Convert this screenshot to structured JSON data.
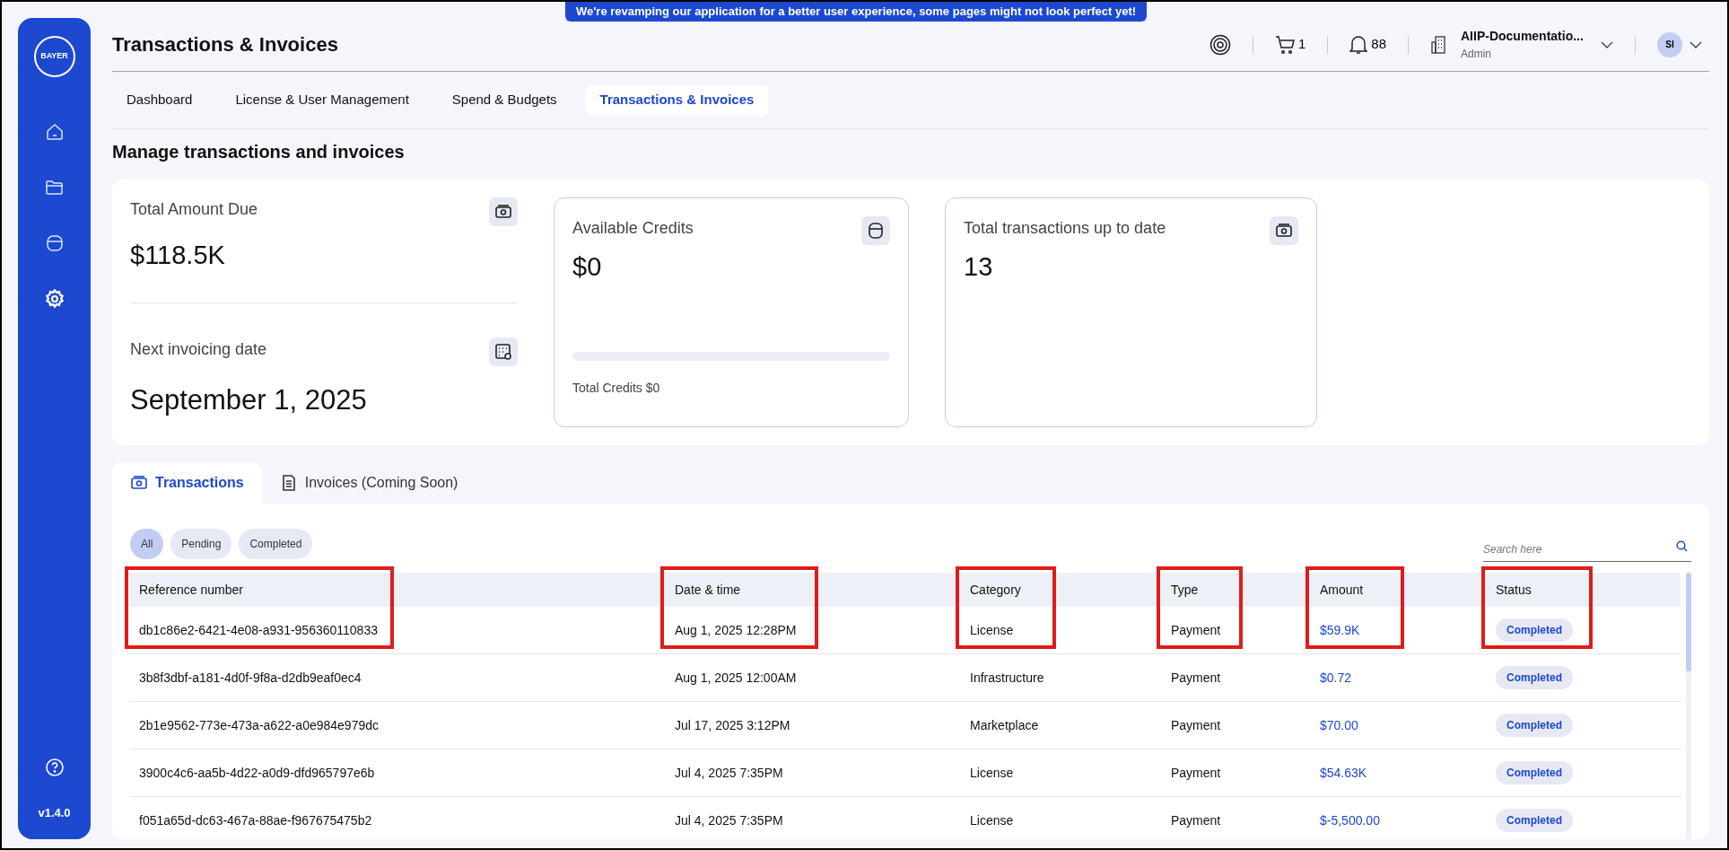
{
  "banner": "We're revamping our application for a better user experience, some pages might not look perfect yet!",
  "sidebar": {
    "logo": "BAYER",
    "items": [
      {
        "selected": false
      },
      {
        "selected": false
      },
      {
        "selected": false
      },
      {
        "selected": true
      }
    ],
    "version": "v1.4.0"
  },
  "header": {
    "title": "Transactions & Invoices",
    "cart_count": "1",
    "notification_count": "88",
    "org_name": "AIIP-Documentatio...",
    "org_role": "Admin",
    "avatar_initials": "SI"
  },
  "nav_tabs": [
    {
      "label": "Dashboard",
      "selected": false
    },
    {
      "label": "License & User Management",
      "selected": false
    },
    {
      "label": "Spend & Budgets",
      "selected": false
    },
    {
      "label": "Transactions & Invoices",
      "selected": true
    }
  ],
  "section_title": "Manage transactions and invoices",
  "summary": {
    "total_amount_due": {
      "label": "Total Amount Due",
      "value": "$118.5K"
    },
    "next_invoicing_date": {
      "label": "Next invoicing date",
      "value": "September 1, 2025"
    }
  },
  "credits": {
    "label": "Available Credits",
    "value": "$0",
    "level": 0,
    "footer": "Total Credits $0"
  },
  "total_transactions": {
    "label": "Total transactions up to date",
    "value": "13"
  },
  "content_tabs": [
    {
      "label": "Transactions",
      "selected": true
    },
    {
      "label": "Invoices (Coming Soon)",
      "selected": false
    }
  ],
  "filters": [
    {
      "label": "All",
      "selected": true
    },
    {
      "label": "Pending",
      "selected": false
    },
    {
      "label": "Completed",
      "selected": false
    }
  ],
  "search": {
    "placeholder": "Search here"
  },
  "table": {
    "columns": [
      {
        "label": "Reference number",
        "highlighted": true
      },
      {
        "label": "Date & time",
        "highlighted": true
      },
      {
        "label": "Category",
        "highlighted": true
      },
      {
        "label": "Type",
        "highlighted": true
      },
      {
        "label": "Amount",
        "highlighted": true
      },
      {
        "label": "Status",
        "highlighted": true
      }
    ],
    "rows": [
      [
        "db1c86e2-6421-4e08-a931-956360110833",
        "Aug 1, 2025 12:28PM",
        "License",
        "Payment",
        "$59.9K",
        "Completed"
      ],
      [
        "3b8f3dbf-a181-4d0f-9f8a-d2db9eaf0ec4",
        "Aug 1, 2025 12:00AM",
        "Infrastructure",
        "Payment",
        "$0.72",
        "Completed"
      ],
      [
        "2b1e9562-773e-473a-a622-a0e984e979dc",
        "Jul 17, 2025 3:12PM",
        "Marketplace",
        "Payment",
        "$70.00",
        "Completed"
      ],
      [
        "3900c4c6-aa5b-4d22-a0d9-dfd965797e6b",
        "Jul 4, 2025 7:35PM",
        "License",
        "Payment",
        "$54.63K",
        "Completed"
      ],
      [
        "f051a65d-dc63-467a-88ae-f967675475b2",
        "Jul 4, 2025 7:35PM",
        "License",
        "Payment",
        "$-5,500.00",
        "Completed"
      ]
    ]
  }
}
